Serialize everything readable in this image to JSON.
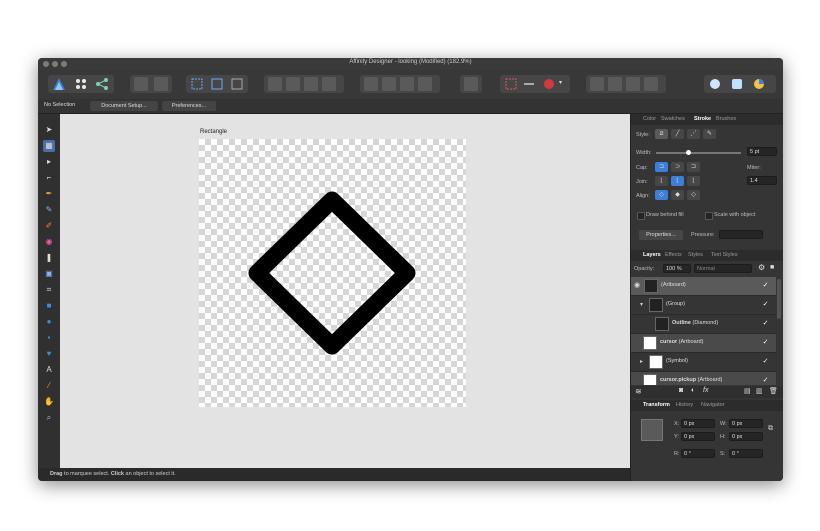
{
  "window": {
    "title": "Affinity Designer - looking (Modified) (182.9%)"
  },
  "context_bar": {
    "selection": "No Selection",
    "document_setup": "Document Setup...",
    "preferences": "Preferences..."
  },
  "canvas": {
    "artboard_label": "Rectangle"
  },
  "status": {
    "drag": "Drag",
    "drag_text": " to marquee select. ",
    "click": "Click",
    "click_text": " an object to select it."
  },
  "stroke_panel": {
    "tabs": [
      "Color",
      "Swatches",
      "Stroke",
      "Brushes"
    ],
    "style_label": "Style:",
    "width_label": "Width:",
    "width_value": "5 pt",
    "width_fraction": 0.35,
    "cap_label": "Cap:",
    "join_label": "Join:",
    "miter_label": "Miter:",
    "miter_value": "1.4",
    "align_label": "Align:",
    "draw_behind_fill": "Draw behind fill",
    "scale_with_object": "Scale with object",
    "properties_button": "Properties...",
    "pressure_label": "Pressure:"
  },
  "layers_panel": {
    "tabs": [
      "Layers",
      "Effects",
      "Styles",
      "Text Styles"
    ],
    "opacity_label": "Opacity:",
    "opacity_value": "100 %",
    "blend_mode": "Normal",
    "rows": [
      {
        "name": "",
        "type": "(Artboard)",
        "selected": true
      },
      {
        "name": "",
        "type": "(Group)",
        "selected": false
      },
      {
        "name": "Outline",
        "type": "(Diamond)",
        "selected": false
      },
      {
        "name": "cursor",
        "type": "(Artboard)",
        "selected": false
      },
      {
        "name": "",
        "type": "(Symbol)",
        "selected": false
      },
      {
        "name": "cursor.pickup",
        "type": "(Artboard)",
        "selected": false
      }
    ]
  },
  "transform_panel": {
    "tabs": [
      "Transform",
      "History",
      "Navigator"
    ],
    "x_label": "X:",
    "x_value": "0 px",
    "y_label": "Y:",
    "y_value": "0 px",
    "w_label": "W:",
    "w_value": "0 px",
    "h_label": "H:",
    "h_value": "0 px",
    "r_label": "R:",
    "r_value": "0 °",
    "s_label": "S:",
    "s_value": "0 °"
  },
  "colors": {
    "accent": "#3d7fd8",
    "background": "#2e2e2e"
  }
}
